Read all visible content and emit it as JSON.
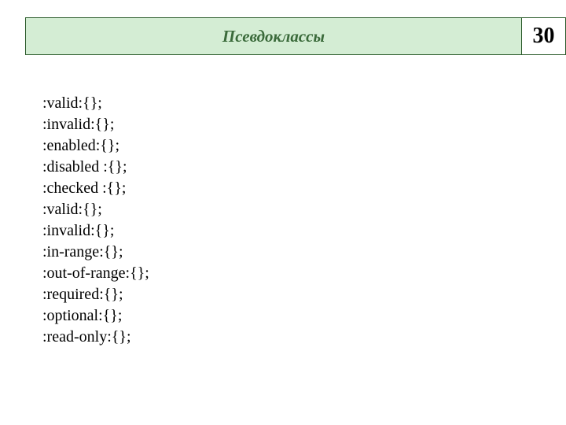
{
  "header": {
    "title": "Псевдоклассы",
    "number": "30"
  },
  "items": [
    ":valid:{};",
    ":invalid:{};",
    ":enabled:{};",
    ":disabled :{};",
    ":checked :{};",
    ":valid:{};",
    ":invalid:{};",
    ":in-range:{};",
    ":out-of-range:{};",
    ":required:{};",
    ":optional:{};",
    ":read-only:{};"
  ]
}
